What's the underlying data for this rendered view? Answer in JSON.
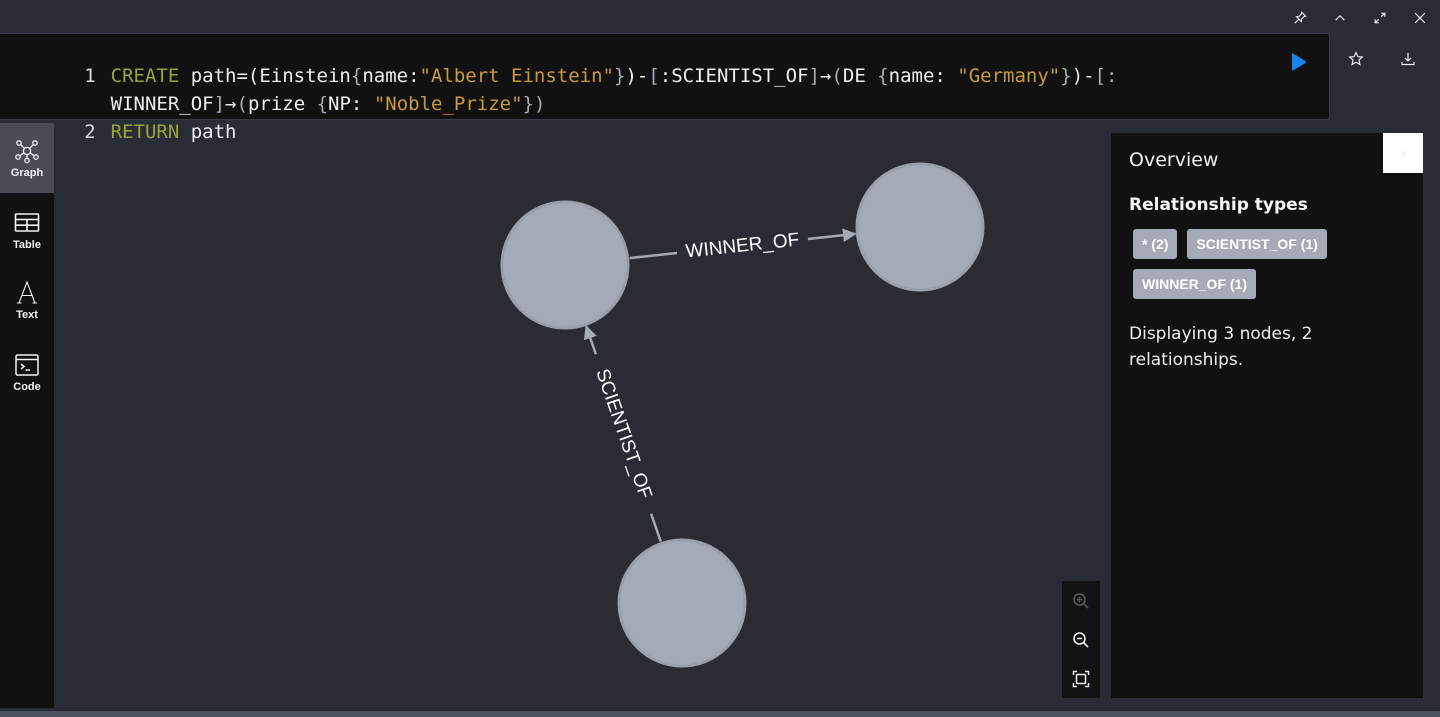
{
  "window_controls": [
    {
      "icon": "pin-icon",
      "label": "Pin"
    },
    {
      "icon": "chevron-up-icon",
      "label": "Collapse"
    },
    {
      "icon": "fullscreen-icon",
      "label": "Fullscreen"
    },
    {
      "icon": "close-icon",
      "label": "Close"
    }
  ],
  "editor": {
    "lines": [
      {
        "number": "1",
        "tokens": [
          {
            "t": "CREATE",
            "c": "kw"
          },
          {
            "t": " path=(Einstein",
            "c": ""
          },
          {
            "t": "{",
            "c": "punc"
          },
          {
            "t": "name:",
            "c": ""
          },
          {
            "t": "\"Albert Einstein\"",
            "c": "str"
          },
          {
            "t": "}",
            "c": "punc"
          },
          {
            "t": ")-",
            "c": ""
          },
          {
            "t": "[",
            "c": "punc"
          },
          {
            "t": ":SCIENTIST_OF",
            "c": ""
          },
          {
            "t": "]",
            "c": "punc"
          },
          {
            "t": "→",
            "c": ""
          },
          {
            "t": "(",
            "c": "punc"
          },
          {
            "t": "DE ",
            "c": ""
          },
          {
            "t": "{",
            "c": "punc"
          },
          {
            "t": "name: ",
            "c": ""
          },
          {
            "t": "\"Germany\"",
            "c": "str"
          },
          {
            "t": "}",
            "c": "punc"
          },
          {
            "t": ")-",
            "c": ""
          },
          {
            "t": "[:",
            "c": "punc"
          }
        ]
      },
      {
        "number": "",
        "tokens": [
          {
            "t": "WINNER_OF",
            "c": ""
          },
          {
            "t": "]",
            "c": "punc"
          },
          {
            "t": "→",
            "c": ""
          },
          {
            "t": "(",
            "c": "punc"
          },
          {
            "t": "prize ",
            "c": ""
          },
          {
            "t": "{",
            "c": "punc"
          },
          {
            "t": "NP: ",
            "c": ""
          },
          {
            "t": "\"Noble_Prize\"",
            "c": "str"
          },
          {
            "t": "}",
            "c": "punc"
          },
          {
            "t": ")",
            "c": "punc"
          }
        ]
      },
      {
        "number": "2",
        "tokens": [
          {
            "t": "RETURN",
            "c": "kw"
          },
          {
            "t": " path",
            "c": ""
          }
        ]
      }
    ],
    "run_icon": "play-icon",
    "run_color": "#1a83f0",
    "favorite_icon": "star-icon",
    "download_icon": "download-icon"
  },
  "leftnav": {
    "items": [
      {
        "label": "Graph",
        "icon": "graph-icon",
        "active": true
      },
      {
        "label": "Table",
        "icon": "table-icon",
        "active": false
      },
      {
        "label": "Text",
        "icon": "text-icon",
        "active": false
      },
      {
        "label": "Code",
        "icon": "code-icon",
        "active": false
      }
    ]
  },
  "graph": {
    "node_color": "#a5abb6",
    "node_border": "#9aa0ab",
    "edge_color": "#a5abb6",
    "label_color": "#ffffff",
    "nodes": [
      {
        "id": "einstein"
      },
      {
        "id": "prize"
      },
      {
        "id": "germany"
      }
    ],
    "relationships": [
      {
        "type": "WINNER_OF",
        "from": "einstein",
        "to": "prize"
      },
      {
        "type": "SCIENTIST_OF",
        "from": "germany",
        "to": "einstein"
      }
    ]
  },
  "zoom_controls": [
    {
      "icon": "zoom-in-icon",
      "label": "Zoom in",
      "disabled": true
    },
    {
      "icon": "zoom-out-icon",
      "label": "Zoom out",
      "disabled": false
    },
    {
      "icon": "fit-to-screen-icon",
      "label": "Fit to screen",
      "disabled": false
    }
  ],
  "overview": {
    "title": "Overview",
    "collapse_icon": "chevron-right-icon",
    "section_title": "Relationship types",
    "chips": [
      "* (2)",
      "SCIENTIST_OF (1)",
      "WINNER_OF (1)"
    ],
    "summary": "Displaying 3 nodes, 2 relationships."
  }
}
